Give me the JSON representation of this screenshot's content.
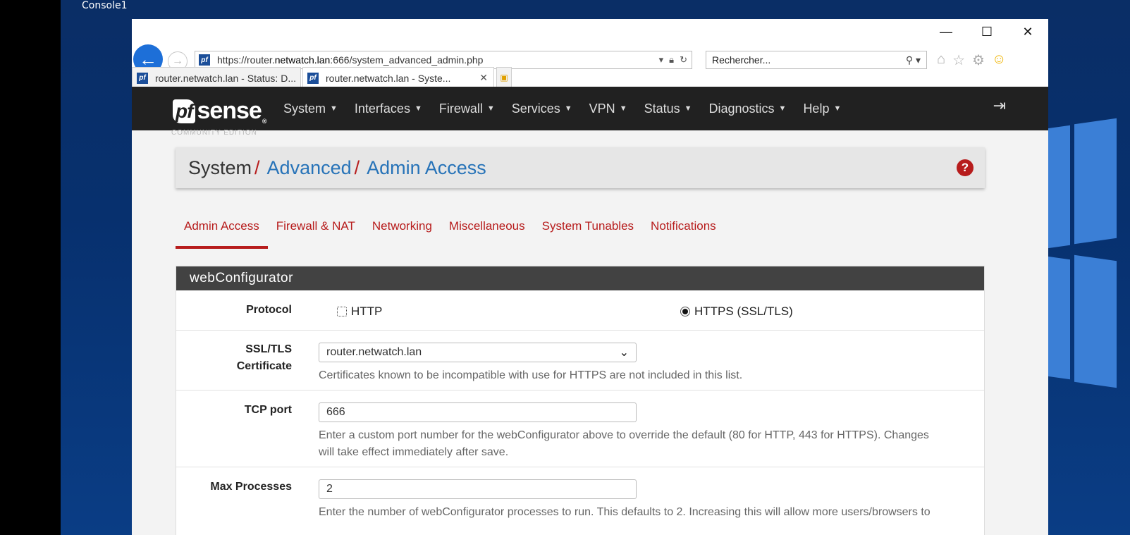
{
  "desktop": {
    "console_label": "Console1"
  },
  "browser": {
    "url_prefix": "https://router.",
    "url_host": "netwatch.lan",
    "url_suffix": ":666/system_advanced_admin.php",
    "search_placeholder": "Rechercher...",
    "tabs": [
      {
        "label": "router.netwatch.lan - Status: D...",
        "active": false
      },
      {
        "label": "router.netwatch.lan - Syste...",
        "active": true
      }
    ]
  },
  "navbar": {
    "logo_pf": "pf",
    "logo_sense": "sense",
    "logo_tm": "®",
    "edition": "COMMUNITY EDITION",
    "menu": [
      "System",
      "Interfaces",
      "Firewall",
      "Services",
      "VPN",
      "Status",
      "Diagnostics",
      "Help"
    ]
  },
  "breadcrumb": {
    "root": "System",
    "level2": "Advanced",
    "level3": "Admin Access",
    "separator": "/"
  },
  "subtabs": [
    "Admin Access",
    "Firewall & NAT",
    "Networking",
    "Miscellaneous",
    "System Tunables",
    "Notifications"
  ],
  "panel": {
    "title": "webConfigurator",
    "protocol": {
      "label": "Protocol",
      "options": [
        "HTTP",
        "HTTPS (SSL/TLS)"
      ],
      "selected": "HTTPS (SSL/TLS)"
    },
    "ssl_cert": {
      "label_line1": "SSL/TLS",
      "label_line2": "Certificate",
      "value": "router.netwatch.lan",
      "help": "Certificates known to be incompatible with use for HTTPS are not included in this list."
    },
    "tcp_port": {
      "label": "TCP port",
      "value": "666",
      "help_line1": "Enter a custom port number for the webConfigurator above to override the default (80 for HTTP, 443 for HTTPS). Changes",
      "help_line2": "will take effect immediately after save."
    },
    "max_processes": {
      "label": "Max Processes",
      "value": "2",
      "help": "Enter the number of webConfigurator processes to run. This defaults to 2. Increasing this will allow more users/browsers to"
    }
  },
  "colors": {
    "accent": "#b71c1c",
    "link": "#2773b8",
    "navbar": "#212121",
    "panel_heading": "#424242"
  }
}
